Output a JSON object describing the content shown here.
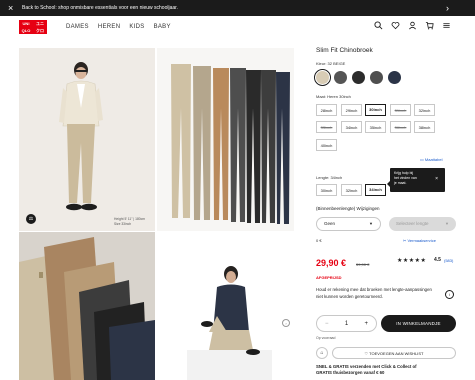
{
  "promo": {
    "text": "Back to School: shop onmisbare essentials voor een nieuw schooljaar.",
    "close_icon": "close-icon",
    "next_icon": "chevron-right-icon"
  },
  "header": {
    "logo_letters": [
      "UNI",
      "ユニ",
      "QLO",
      "クロ"
    ],
    "nav": [
      "DAMES",
      "HEREN",
      "KIDS",
      "BABY"
    ],
    "icons": [
      "search-icon",
      "heart-icon",
      "user-icon",
      "cart-icon",
      "menu-icon"
    ]
  },
  "gallery": {
    "model_info": [
      "Height 5' 11\" | 180cm",
      "Size 33inch"
    ],
    "scale_icon": "scale-icon"
  },
  "product": {
    "title": "Slim Fit Chinobroek",
    "color_label": "Kleur: 32 BEIGE",
    "colors": [
      "#d8ccb5",
      "#555555",
      "#2c2c2c",
      "#4f4f4f",
      "#2b3447"
    ],
    "length_label": "Maat: Heren 30inch",
    "sizes_row1": [
      "28inch",
      "29inch",
      "30inch",
      "31inch",
      "32inch"
    ],
    "sizes_row2": [
      "33inch",
      "34inch",
      "35inch",
      "36inch",
      "38inch"
    ],
    "sizes_row3": [
      "40inch"
    ],
    "size_chart": "Maattabel",
    "tooltip": [
      "Krijg hulp bij",
      "het vinden van",
      "je maat."
    ],
    "inseam_label": "Lengte: 34inch",
    "inseams": [
      "30inch",
      "32inch",
      "34inch"
    ],
    "alterations_label": "(Binnenbeenlengte) Wijzigingen",
    "alter_select": "Geen",
    "length_select_placeholder": "Selecteer lengte",
    "price_note": "0 €",
    "alteration_service": "Vermaakservice",
    "price": "29,90 €",
    "old_price": "39,90 €",
    "stars": "★★★★★",
    "rating": "4.5",
    "reviews": "(583)",
    "discount": "AFGEPRIJSD",
    "description": "Houd er rekening mee dat broeken met lengte-aanpassingen niet kunnen worden geretourneerd.",
    "quantity": "1",
    "cart_button": "IN WINKELMANDJE",
    "stock": "Op voorraad",
    "wishlist_button": "TOEVOEGEN AAN WISHLIST",
    "shipping": [
      "SNEL & GRATIS verzenden met Click & Collect of",
      "GRATIS thuisbezorgen vanaf € 60"
    ]
  }
}
